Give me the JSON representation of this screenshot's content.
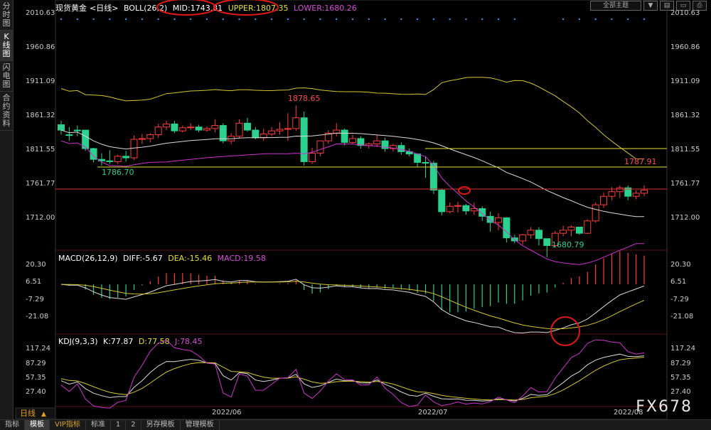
{
  "left_tabs": [
    "分时图",
    "K线图",
    "闪电图",
    "合约资料"
  ],
  "left_tab_active": 1,
  "toolbar": {
    "theme_label": "全部主题",
    "icons": [
      "dropdown-icon",
      "layout-icon",
      "window-icon",
      "print-icon"
    ]
  },
  "main_legend": {
    "instrument": "现货黄金",
    "period": "<日线>",
    "indicator": "BOLL(26,2)",
    "mid": "MID:1743.81",
    "upper": "UPPER:1807.35",
    "lower": "LOWER:1680.26"
  },
  "price_axis": [
    "2010.63",
    "1960.86",
    "1911.09",
    "1861.32",
    "1811.55",
    "1761.77",
    "1712.00"
  ],
  "annotations": {
    "high": "1878.65",
    "low1": "1786.70",
    "low2": "1680.79",
    "recent_high": "1787.91"
  },
  "macd_legend": {
    "title": "MACD(26,12,9)",
    "diff": "DIFF:-5.67",
    "dea": "DEA:-15.46",
    "macd": "MACD:19.58"
  },
  "macd_axis": [
    "20.30",
    "6.51",
    "-7.29",
    "-21.08"
  ],
  "kdj_legend": {
    "title": "KDJ(9,3,3)",
    "k": "K:77.87",
    "d": "D:77.58",
    "j": "J:78.45"
  },
  "kdj_axis": [
    "117.24",
    "87.29",
    "57.35",
    "27.40"
  ],
  "date_labels": [
    "2022/06",
    "2022/07",
    "2022/08"
  ],
  "period_button": "日线",
  "bottom_tabs": [
    "指标",
    "模板",
    "VIP指标",
    "标准",
    "1",
    "2",
    "另存模板",
    "管理模板"
  ],
  "bottom_tab_active": 1,
  "watermark": "FX678",
  "colors": {
    "up": "#ff3b3b",
    "down": "#2ad18f",
    "mid": "#d9d9d9",
    "upper": "#d4c634",
    "lower": "#cc33cc",
    "dea": "#d4c634",
    "diff": "#d9d9d9",
    "j": "#cc33cc"
  },
  "chart_data": {
    "type": "candlestick",
    "series_main": {
      "candles": [
        [
          1853,
          1858,
          1846,
          1840
        ],
        [
          1840,
          1850,
          1839,
          1832
        ],
        [
          1846,
          1852,
          1845,
          1838
        ],
        [
          1846,
          1846,
          1822,
          1819
        ],
        [
          1822,
          1823,
          1808,
          1804
        ],
        [
          1808,
          1816,
          1806,
          1800
        ],
        [
          1806,
          1820,
          1805,
          1802
        ],
        [
          1805,
          1814,
          1812,
          1802
        ],
        [
          1812,
          1819,
          1810,
          1805
        ],
        [
          1810,
          1839,
          1834,
          1807
        ],
        [
          1834,
          1841,
          1835,
          1828
        ],
        [
          1835,
          1842,
          1840,
          1830
        ],
        [
          1840,
          1854,
          1850,
          1836
        ],
        [
          1850,
          1858,
          1854,
          1846
        ],
        [
          1854,
          1858,
          1845,
          1842
        ],
        [
          1845,
          1852,
          1849,
          1843
        ],
        [
          1849,
          1855,
          1850,
          1846
        ],
        [
          1850,
          1853,
          1846,
          1843
        ],
        [
          1846,
          1851,
          1848,
          1844
        ],
        [
          1848,
          1860,
          1852,
          1843
        ],
        [
          1852,
          1855,
          1832,
          1829
        ],
        [
          1832,
          1842,
          1838,
          1828
        ],
        [
          1838,
          1860,
          1855,
          1835
        ],
        [
          1855,
          1862,
          1846,
          1844
        ],
        [
          1846,
          1850,
          1836,
          1834
        ],
        [
          1836,
          1848,
          1841,
          1832
        ],
        [
          1841,
          1850,
          1845,
          1838
        ],
        [
          1845,
          1856,
          1847,
          1840
        ],
        [
          1847,
          1868,
          1848,
          1832
        ],
        [
          1848,
          1878,
          1862,
          1845
        ],
        [
          1862,
          1870,
          1805,
          1800
        ],
        [
          1805,
          1823,
          1816,
          1802
        ],
        [
          1816,
          1822,
          1832,
          1812
        ],
        [
          1832,
          1846,
          1842,
          1828
        ],
        [
          1842,
          1855,
          1846,
          1838
        ],
        [
          1846,
          1848,
          1830,
          1826
        ],
        [
          1830,
          1840,
          1835,
          1828
        ],
        [
          1835,
          1838,
          1826,
          1822
        ],
        [
          1826,
          1830,
          1828,
          1822
        ],
        [
          1828,
          1840,
          1832,
          1824
        ],
        [
          1832,
          1836,
          1822,
          1818
        ],
        [
          1822,
          1828,
          1826,
          1818
        ],
        [
          1826,
          1830,
          1818,
          1814
        ],
        [
          1818,
          1822,
          1815,
          1812
        ],
        [
          1815,
          1816,
          1804,
          1798
        ],
        [
          1804,
          1812,
          1803,
          1784
        ],
        [
          1803,
          1806,
          1768,
          1763
        ],
        [
          1768,
          1770,
          1740,
          1735
        ],
        [
          1740,
          1752,
          1747,
          1738
        ],
        [
          1747,
          1753,
          1748,
          1739
        ],
        [
          1748,
          1750,
          1741,
          1736
        ],
        [
          1741,
          1752,
          1744,
          1736
        ],
        [
          1744,
          1747,
          1734,
          1728
        ],
        [
          1734,
          1740,
          1726,
          1714
        ],
        [
          1726,
          1738,
          1732,
          1716
        ],
        [
          1732,
          1733,
          1706,
          1700
        ],
        [
          1706,
          1710,
          1702,
          1699
        ],
        [
          1702,
          1711,
          1710,
          1697
        ],
        [
          1710,
          1720,
          1716,
          1705
        ],
        [
          1716,
          1720,
          1705,
          1696
        ],
        [
          1705,
          1705,
          1696,
          1681
        ],
        [
          1696,
          1715,
          1712,
          1694
        ],
        [
          1712,
          1722,
          1716,
          1708
        ],
        [
          1716,
          1722,
          1720,
          1708
        ],
        [
          1720,
          1720,
          1712,
          1710
        ],
        [
          1712,
          1730,
          1728,
          1711
        ],
        [
          1728,
          1752,
          1749,
          1726
        ],
        [
          1749,
          1765,
          1760,
          1745
        ],
        [
          1760,
          1772,
          1766,
          1755
        ],
        [
          1766,
          1774,
          1771,
          1758
        ],
        [
          1771,
          1774,
          1760,
          1755
        ],
        [
          1760,
          1768,
          1764,
          1756
        ],
        [
          1764,
          1774,
          1768,
          1760
        ]
      ],
      "ylim": [
        1690,
        2015
      ]
    },
    "macd": {
      "ylim": [
        -32,
        22
      ]
    },
    "kdj": {
      "ylim": [
        0,
        125
      ]
    }
  }
}
